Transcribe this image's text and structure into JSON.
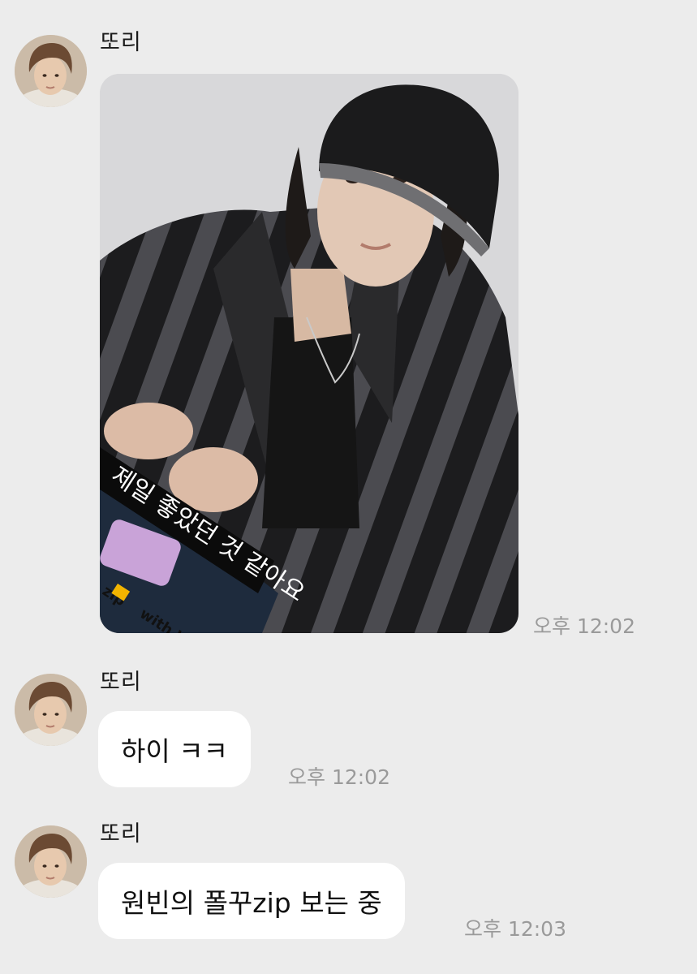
{
  "messages": [
    {
      "sender": "또리",
      "type": "photo",
      "photo_caption_lines": [
        "제일 좋았던 것 같아요",
        "zip",
        "with W"
      ],
      "time": "오후 12:02"
    },
    {
      "sender": "또리",
      "type": "text",
      "text": "하이 ㅋㅋ",
      "time": "오후 12:02"
    },
    {
      "sender": "또리",
      "type": "text",
      "text": "원빈의 폴꾸zip 보는 중",
      "time": "오후 12:03"
    }
  ],
  "colors": {
    "background": "#ececec",
    "bubble": "#ffffff",
    "timestamp": "#9a9a9a"
  },
  "icons": {
    "avatar": "profile-photo",
    "photo": "shared-photo"
  }
}
